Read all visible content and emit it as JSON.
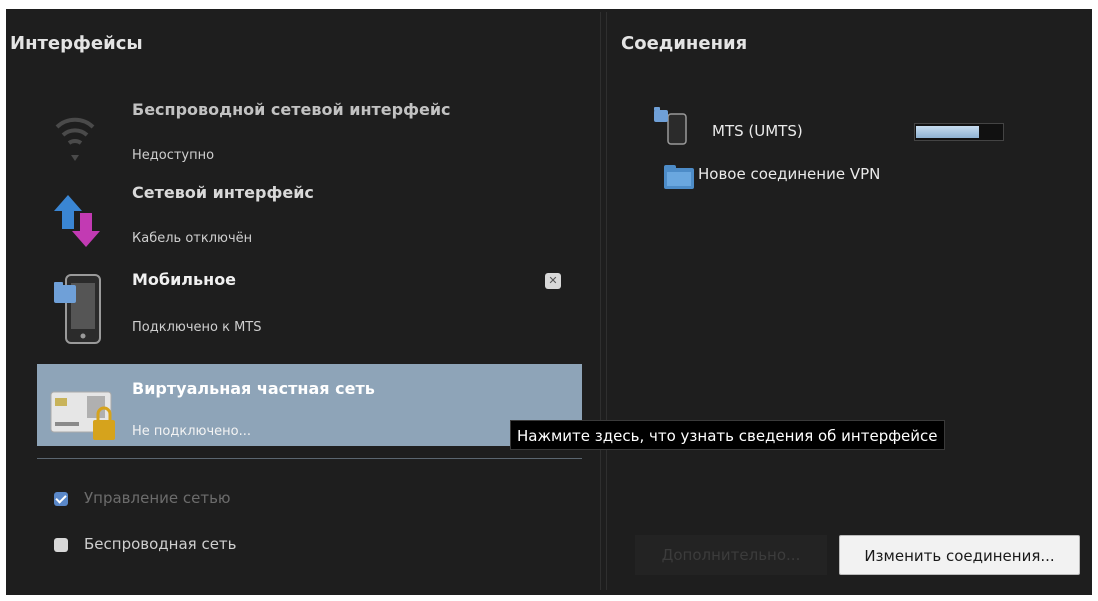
{
  "interfaces_panel": {
    "heading": "Интерфейсы",
    "items": [
      {
        "title": "Беспроводной сетевой интерфейс",
        "status": "Недоступно",
        "icon": "wifi-icon"
      },
      {
        "title": "Сетевой интерфейс",
        "status": "Кабель отключён",
        "icon": "network-arrows-icon"
      },
      {
        "title": "Мобильное",
        "status": "Подключено к MTS",
        "icon": "mobile-phone-icon"
      },
      {
        "title": "Виртуальная частная сеть",
        "status": "Не подключено...",
        "icon": "vpn-card-lock-icon"
      }
    ],
    "options": [
      {
        "label": "Управление сетью",
        "checked": true
      },
      {
        "label": "Беспроводная сеть",
        "checked": false
      }
    ]
  },
  "connections_panel": {
    "heading": "Соединения",
    "items": [
      {
        "label": "MTS (UMTS)",
        "icon": "mobile-connection-icon",
        "signal_fraction": 0.72
      },
      {
        "label": "Новое соединение VPN",
        "icon": "folder-icon"
      }
    ],
    "buttons": {
      "advanced": "Дополнительно...",
      "edit_connections": "Изменить соединения..."
    }
  },
  "tooltip": {
    "text": "Нажмите здесь, что узнать сведения об интерфейсе"
  },
  "colors": {
    "background": "#1e1e1e",
    "selection": "#8ea4b8",
    "accent": "#5a88c9"
  }
}
